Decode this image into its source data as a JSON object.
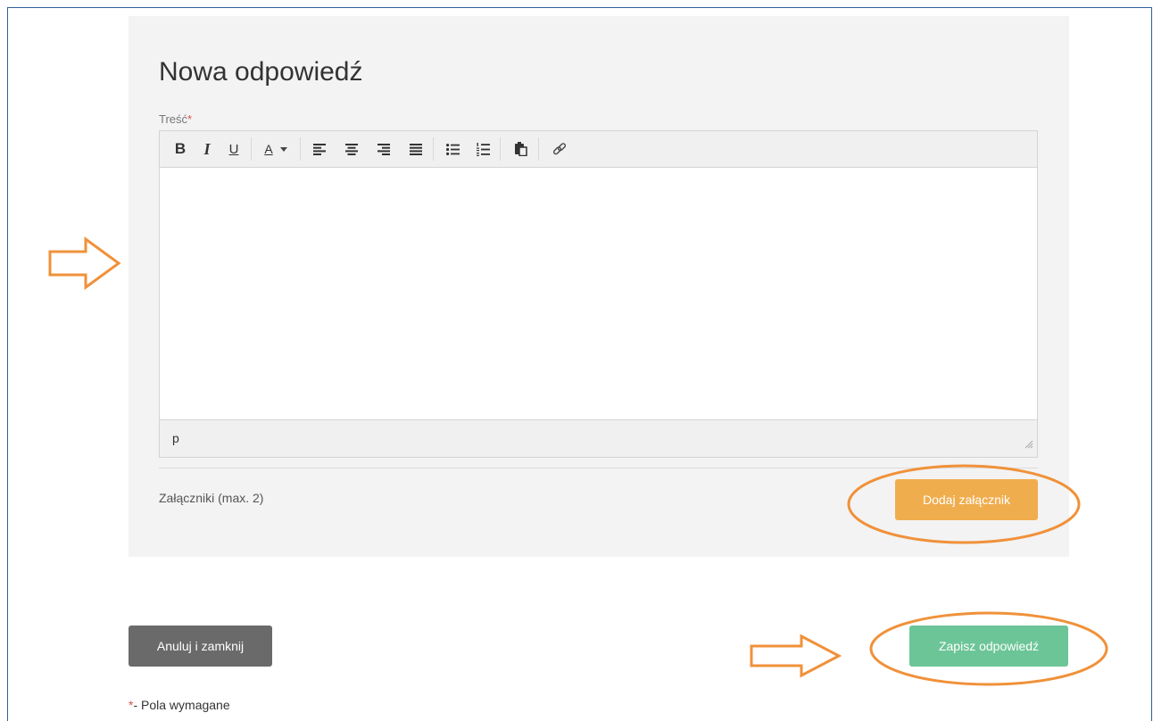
{
  "form": {
    "title": "Nowa odpowiedź",
    "content_label": "Treść",
    "required_marker": "*"
  },
  "editor": {
    "toolbar": [
      {
        "name": "bold-button",
        "icon": "bold-icon",
        "glyph": "B"
      },
      {
        "name": "italic-button",
        "icon": "italic-icon",
        "glyph": "I"
      },
      {
        "name": "underline-button",
        "icon": "underline-icon",
        "glyph": "U"
      },
      {
        "name": "text-color-button",
        "icon": "text-color-icon",
        "glyph": "A"
      },
      {
        "name": "align-left-button",
        "icon": "align-left-icon"
      },
      {
        "name": "align-center-button",
        "icon": "align-center-icon"
      },
      {
        "name": "align-right-button",
        "icon": "align-right-icon"
      },
      {
        "name": "align-justify-button",
        "icon": "align-justify-icon"
      },
      {
        "name": "bullet-list-button",
        "icon": "bullet-list-icon"
      },
      {
        "name": "numbered-list-button",
        "icon": "numbered-list-icon"
      },
      {
        "name": "paste-button",
        "icon": "paste-icon"
      },
      {
        "name": "link-button",
        "icon": "link-icon"
      }
    ],
    "content": "",
    "status_path": "p"
  },
  "attachments": {
    "label": "Załączniki (max. 2)",
    "add_button": "Dodaj załącznik"
  },
  "actions": {
    "cancel_button": "Anuluj i zamknij",
    "save_button": "Zapisz odpowiedź"
  },
  "footer": {
    "required_marker": "*",
    "required_note": "- Pola wymagane"
  },
  "colors": {
    "annotation": "#f0913a",
    "attach_button": "#f0ad4e",
    "save_button": "#6cc597",
    "cancel_button": "#6a6a6a",
    "panel": "#f3f3f3",
    "required": "#d9534f"
  }
}
